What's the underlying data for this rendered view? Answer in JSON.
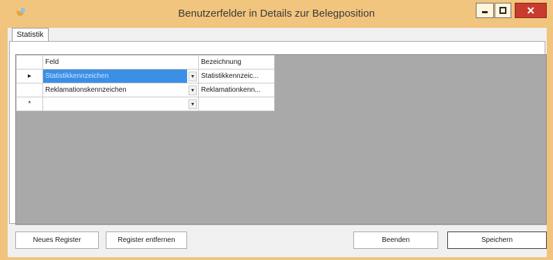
{
  "window": {
    "title": "Benutzerfelder in Details zur Belegposition"
  },
  "tabs": [
    {
      "label": "Statistik"
    }
  ],
  "grid": {
    "headers": {
      "feld": "Feld",
      "bezeichnung": "Bezeichnung"
    },
    "rows": [
      {
        "indicator": "▸",
        "feld": "Statistikkennzeichen",
        "bezeichnung": "Statistikkennzeic..."
      },
      {
        "indicator": "",
        "feld": "Reklamationskennzeichen",
        "bezeichnung": "Reklamationkenn..."
      },
      {
        "indicator": "*",
        "feld": "",
        "bezeichnung": ""
      }
    ]
  },
  "buttons": {
    "new_tab": "Neues Register",
    "remove_tab": "Register entfernen",
    "quit": "Beenden",
    "save": "Speichern"
  },
  "colors": {
    "titlebar": "#f1c57d",
    "selection": "#3b8fe5",
    "close": "#c93a2f"
  }
}
